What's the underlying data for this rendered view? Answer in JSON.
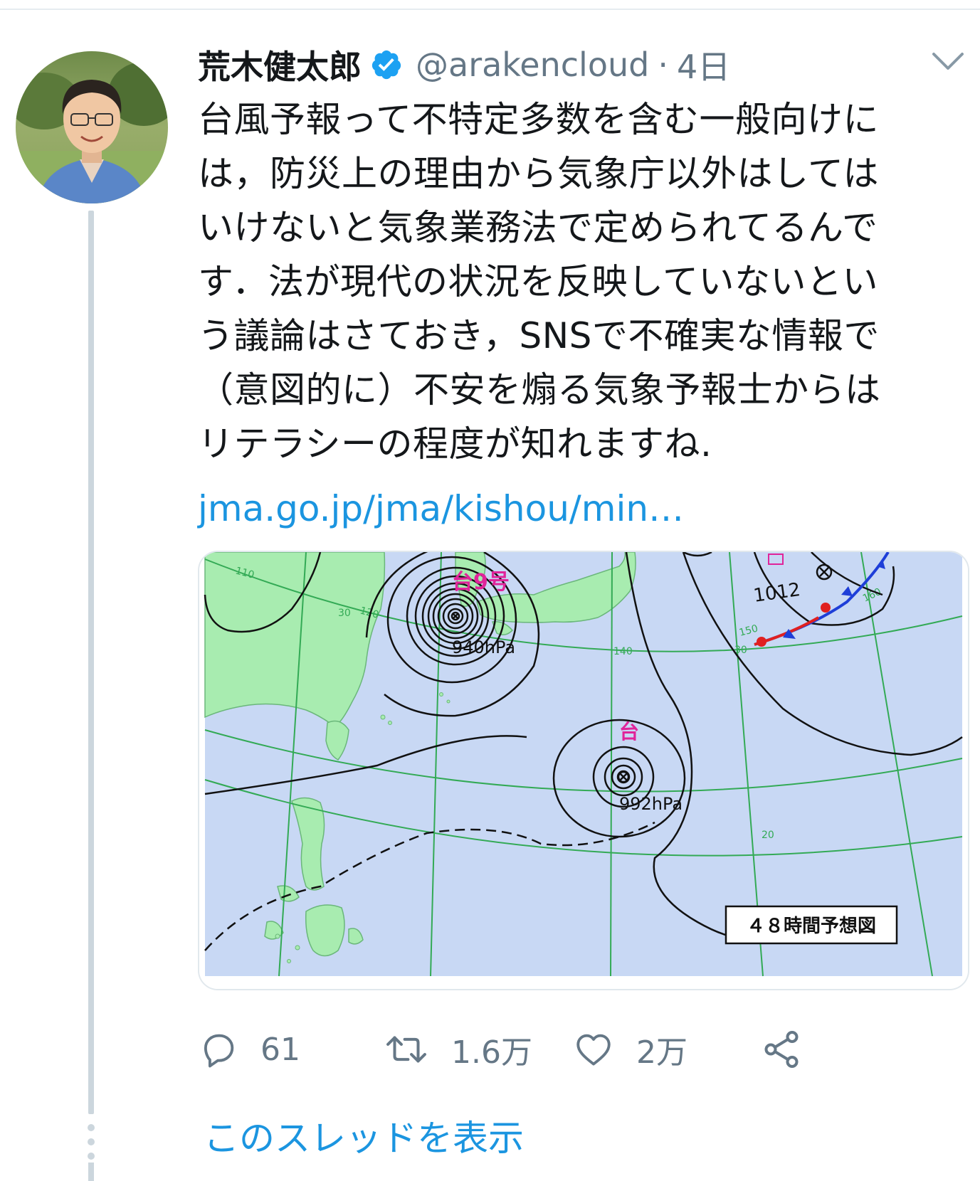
{
  "user": {
    "display_name": "荒木健太郎",
    "handle": "@arakencloud",
    "separator": "·",
    "time": "4日",
    "verified": true
  },
  "tweet": {
    "lines": [
      "台風予報って不特定多数を含む一般向けに",
      "は，防災上の理由から気象庁以外はしては",
      "いけないと気象業務法で定められてるんで",
      "す．法が現代の状況を反映していないとい",
      "う議論はさておき，SNSで不確実な情報で",
      "（意図的に）不安を煽る気象予報士からは",
      "リテラシーの程度が知れますね."
    ],
    "link": "jma.go.jp/jma/kishou/min…"
  },
  "map": {
    "typhoon9_label": "台9号",
    "typhoon9_pressure": "940hPa",
    "typhoon2_label": "台",
    "typhoon2_pressure": "992hPa",
    "high_pressure": "1012",
    "forecast_label": "４８時間予想図",
    "lat_labels": [
      "30",
      "20",
      "30"
    ],
    "lon_labels": [
      "110",
      "120",
      "140",
      "150",
      "160"
    ],
    "colors": {
      "sea": "#c8d8f4",
      "land": "#a8ecb0",
      "grid": "#33aa55",
      "isobar": "#111111",
      "label": "#e0249a",
      "warm_front": "#e02020",
      "cold_front": "#1e3ed8"
    }
  },
  "actions": {
    "reply": {
      "icon": "reply-icon",
      "count": "61"
    },
    "retweet": {
      "icon": "retweet-icon",
      "count": "1.6万"
    },
    "like": {
      "icon": "heart-icon",
      "count": "2万"
    },
    "share": {
      "icon": "share-icon"
    }
  },
  "show_thread": "このスレッドを表示",
  "colors": {
    "link": "#1b95e0",
    "secondary": "#657786",
    "verified": "#1da1f2",
    "thread_line": "#ccd6dd"
  }
}
